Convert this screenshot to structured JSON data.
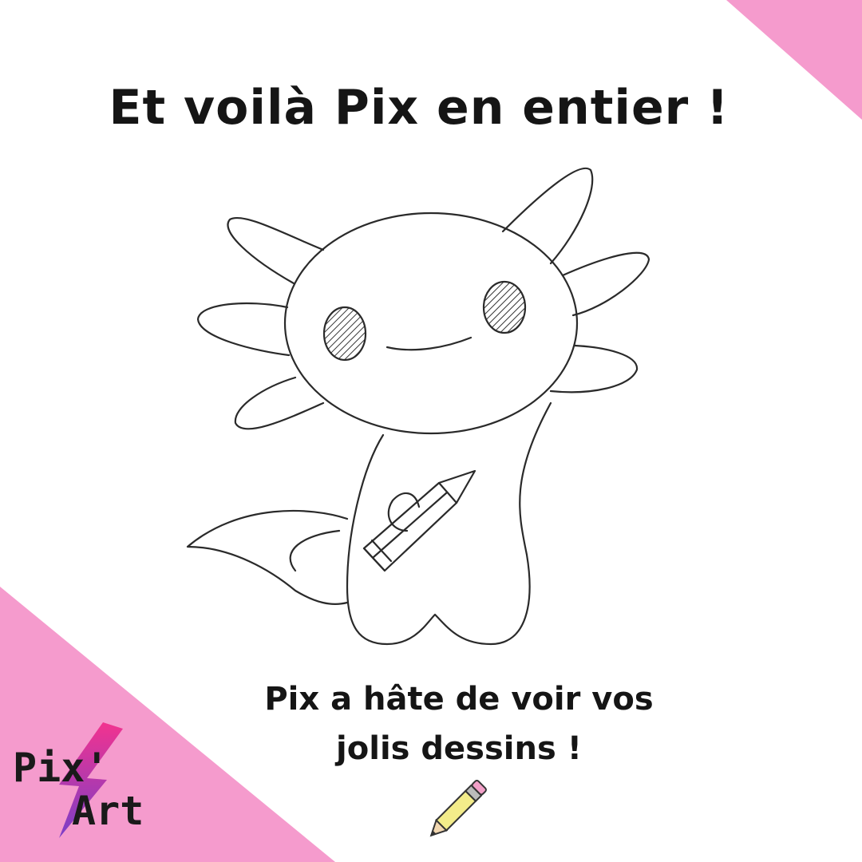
{
  "title": "Et voilà Pix en entier !",
  "caption": {
    "line1": "Pix a hâte de voir vos",
    "line2": "jolis dessins !"
  },
  "logo": {
    "line1": "Pix'",
    "line2": "Art"
  },
  "colors": {
    "accent_pink": "#f59bcd",
    "ink": "#151515",
    "pencil_yellow": "#f3ec8a",
    "pencil_eraser": "#f2a0c8"
  },
  "icons": [
    "axolotl-drawing",
    "pencil-icon",
    "lightning-bolt-icon"
  ]
}
